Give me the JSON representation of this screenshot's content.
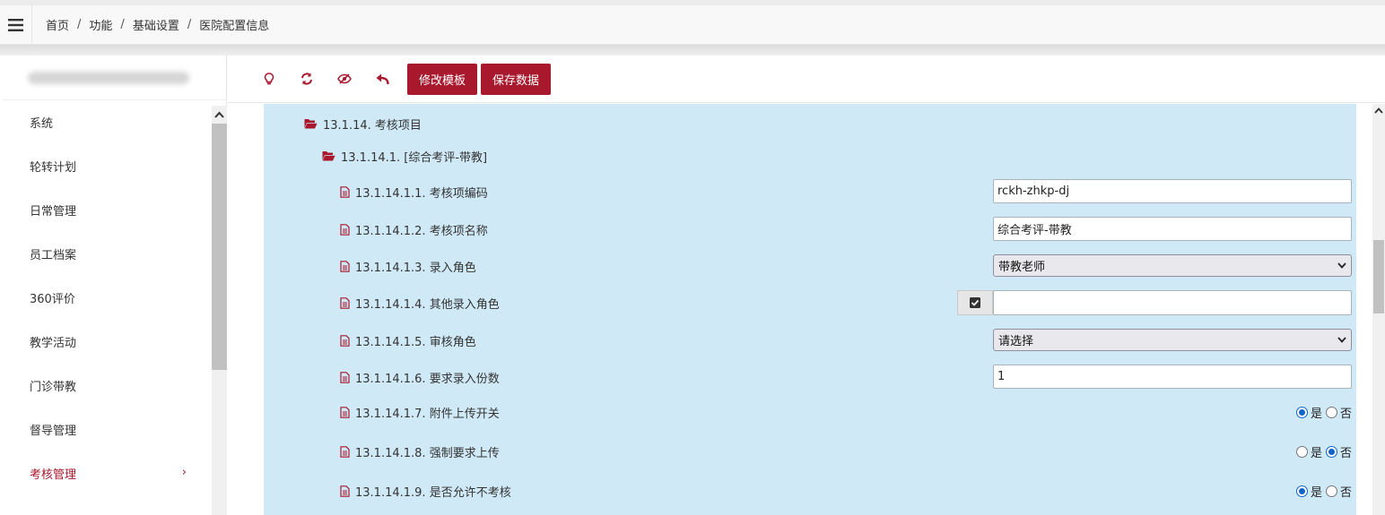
{
  "header": {
    "breadcrumb": [
      "首页",
      "功能",
      "基础设置",
      "医院配置信息"
    ],
    "separator": "/"
  },
  "sidebar": {
    "items": [
      {
        "label": "系统"
      },
      {
        "label": "轮转计划"
      },
      {
        "label": "日常管理"
      },
      {
        "label": "员工档案"
      },
      {
        "label": "360评价"
      },
      {
        "label": "教学活动"
      },
      {
        "label": "门诊带教"
      },
      {
        "label": "督导管理"
      },
      {
        "label": "考核管理",
        "active": true
      }
    ],
    "active_chevron": "›"
  },
  "toolbar": {
    "icons": [
      "lightbulb-icon",
      "refresh-icon",
      "eye-slash-icon",
      "undo-icon"
    ],
    "edit_template_label": "修改模板",
    "save_data_label": "保存数据"
  },
  "tree": {
    "node_l1": "13.1.14. 考核项目",
    "node_l2": "13.1.14.1. [综合考评-带教]",
    "rows": [
      {
        "label": "13.1.14.1.1. 考核项编码",
        "type": "text",
        "value": "rckh-zhkp-dj"
      },
      {
        "label": "13.1.14.1.2. 考核项名称",
        "type": "text",
        "value": "综合考评-带教"
      },
      {
        "label": "13.1.14.1.3. 录入角色",
        "type": "select",
        "value": "带教老师"
      },
      {
        "label": "13.1.14.1.4. 其他录入角色",
        "type": "checkbox-text",
        "value": ""
      },
      {
        "label": "13.1.14.1.5. 审核角色",
        "type": "select",
        "value": "请选择"
      },
      {
        "label": "13.1.14.1.6. 要求录入份数",
        "type": "text",
        "value": "1"
      },
      {
        "label": "13.1.14.1.7. 附件上传开关",
        "type": "radio",
        "yes": "是",
        "no": "否",
        "selected": "yes"
      },
      {
        "label": "13.1.14.1.8. 强制要求上传",
        "type": "radio",
        "yes": "是",
        "no": "否",
        "selected": "no"
      },
      {
        "label": "13.1.14.1.9. 是否允许不考核",
        "type": "radio",
        "yes": "是",
        "no": "否",
        "selected": "yes"
      }
    ]
  },
  "colors": {
    "brand_red": "#a8192e",
    "panel_blue": "#d0e9f7",
    "radio_blue": "#0e63c9"
  }
}
